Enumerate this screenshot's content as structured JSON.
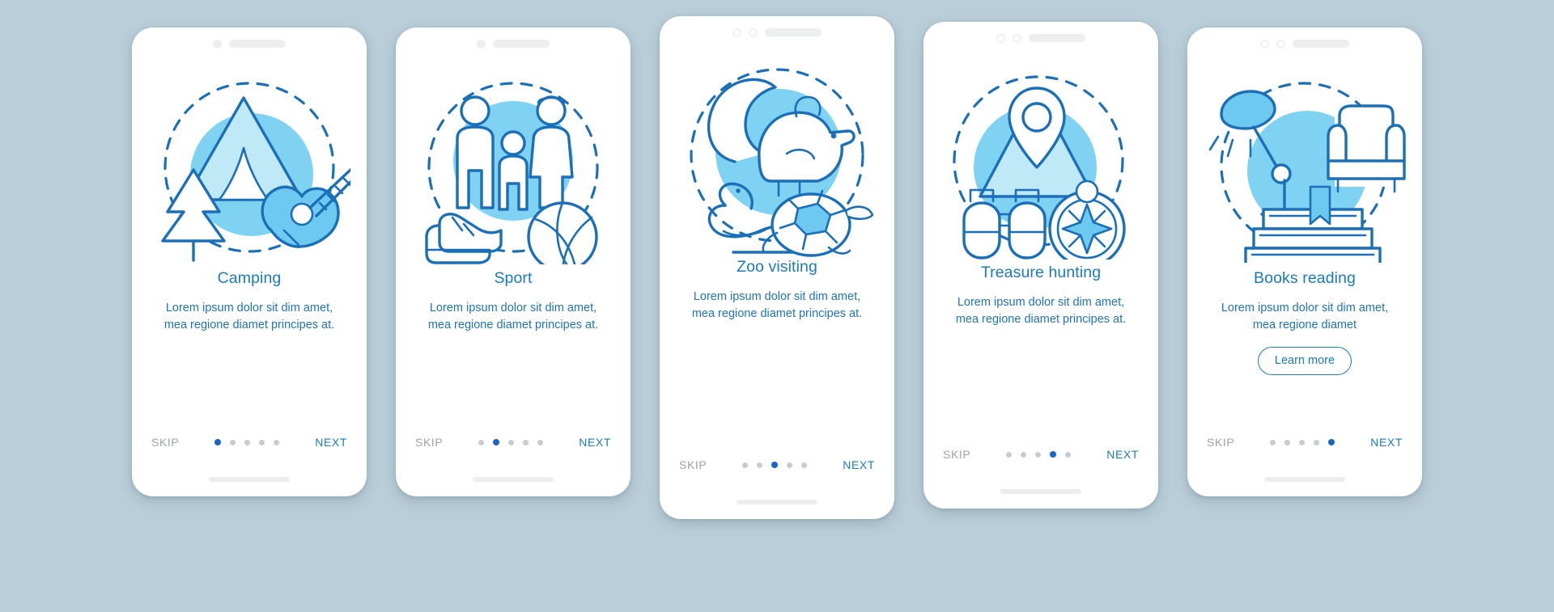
{
  "meta": {
    "background_color": "#b9ced9",
    "accent_color": "#1b7ac0",
    "accent_dark": "#1568c4",
    "muted_color": "#9aa3a9",
    "illustration_light": "#bfe9f7",
    "illustration_mid": "#7fd2f2",
    "illustration_stroke": "#1b6fb8"
  },
  "nav": {
    "skip_label": "SKIP",
    "next_label": "NEXT",
    "dot_count": 5
  },
  "screens": [
    {
      "id": "camping",
      "title": "Camping",
      "description": "Lorem ipsum dolor sit dim amet, mea regione diamet principes at.",
      "active_dot": 1,
      "skip_label": "SKIP",
      "next_label": "NEXT",
      "icon": "tent-guitar-tree-icon",
      "has_learn_more": false,
      "notch_style": "single-dot"
    },
    {
      "id": "sport",
      "title": "Sport",
      "description": "Lorem ipsum dolor sit dim amet, mea regione diamet principes at.",
      "active_dot": 2,
      "skip_label": "SKIP",
      "next_label": "NEXT",
      "icon": "family-sneakers-ball-icon",
      "has_learn_more": false,
      "notch_style": "single-dot"
    },
    {
      "id": "zoo-visiting",
      "title": "Zoo visiting",
      "description": "Lorem ipsum dolor sit dim amet, mea regione diamet principes at.",
      "active_dot": 3,
      "skip_label": "SKIP",
      "next_label": "NEXT",
      "icon": "squirrel-snake-turtle-icon",
      "has_learn_more": false,
      "notch_style": "double-ring"
    },
    {
      "id": "treasure-hunting",
      "title": "Treasure hunting",
      "description": "Lorem ipsum dolor sit dim amet, mea regione diamet principes at.",
      "active_dot": 4,
      "skip_label": "SKIP",
      "next_label": "NEXT",
      "icon": "map-pin-binoculars-compass-icon",
      "has_learn_more": false,
      "notch_style": "double-ring"
    },
    {
      "id": "books-reading",
      "title": "Books reading",
      "description": "Lorem ipsum dolor sit dim amet, mea regione diamet",
      "active_dot": 5,
      "skip_label": "SKIP",
      "next_label": "NEXT",
      "icon": "lamp-armchair-books-icon",
      "has_learn_more": true,
      "learn_more_label": "Learn more",
      "notch_style": "double-ring"
    }
  ]
}
